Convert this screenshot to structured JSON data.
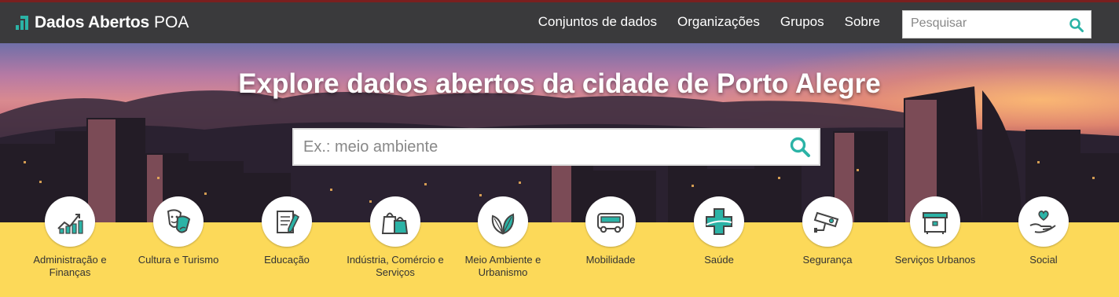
{
  "brand": {
    "bold": "Dados Abertos",
    "light": "POA"
  },
  "nav": {
    "links": [
      "Conjuntos de dados",
      "Organizações",
      "Grupos",
      "Sobre"
    ],
    "search_placeholder": "Pesquisar"
  },
  "hero": {
    "title": "Explore dados abertos da cidade de Porto Alegre",
    "search_placeholder": "Ex.: meio ambiente"
  },
  "categories": [
    {
      "label": "Administração e Finanças",
      "icon": "finance-chart-icon"
    },
    {
      "label": "Cultura e Turismo",
      "icon": "theater-masks-icon"
    },
    {
      "label": "Educação",
      "icon": "notebook-pencil-icon"
    },
    {
      "label": "Indústria, Comércio e Serviços",
      "icon": "shopping-bags-icon"
    },
    {
      "label": "Meio Ambiente e Urbanismo",
      "icon": "leaves-icon"
    },
    {
      "label": "Mobilidade",
      "icon": "bus-icon"
    },
    {
      "label": "Saúde",
      "icon": "health-cross-icon"
    },
    {
      "label": "Segurança",
      "icon": "security-camera-icon"
    },
    {
      "label": "Serviços Urbanos",
      "icon": "dumpster-icon"
    },
    {
      "label": "Social",
      "icon": "hand-heart-icon"
    }
  ],
  "colors": {
    "accent": "#2bb3a6",
    "navbar": "#3a3a3c",
    "band": "#fcd959",
    "icon_stroke": "#444444"
  }
}
